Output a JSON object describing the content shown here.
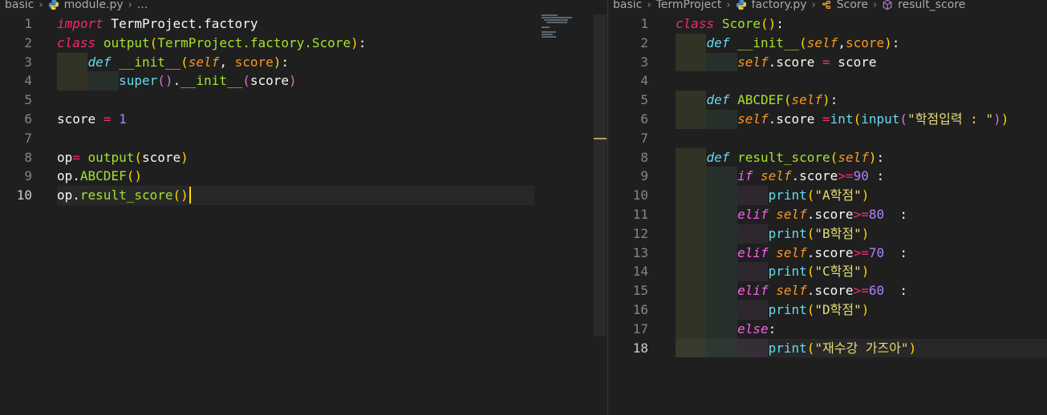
{
  "left": {
    "breadcrumb": [
      "basic",
      "module.py",
      "..."
    ],
    "lines": [
      {
        "n": "1",
        "tokens": [
          [
            "kw",
            "import"
          ],
          [
            "pl",
            " TermProject.factory"
          ]
        ]
      },
      {
        "n": "2",
        "tokens": [
          [
            "kw",
            "class"
          ],
          [
            "pl",
            " "
          ],
          [
            "cls",
            "output"
          ],
          [
            "brk1",
            "("
          ],
          [
            "cls",
            "TermProject.factory.Score"
          ],
          [
            "brk1",
            ")"
          ],
          [
            "pl",
            ":"
          ]
        ]
      },
      {
        "n": "3",
        "tokens": [
          [
            "pl",
            "    "
          ],
          [
            "kw2",
            "def"
          ],
          [
            "pl",
            " "
          ],
          [
            "def-name",
            "__init__"
          ],
          [
            "brk1",
            "("
          ],
          [
            "selfp",
            "self"
          ],
          [
            "pl",
            ", "
          ],
          [
            "param",
            "score"
          ],
          [
            "brk1",
            ")"
          ],
          [
            "pl",
            ":"
          ]
        ]
      },
      {
        "n": "4",
        "tokens": [
          [
            "pl",
            "        "
          ],
          [
            "bi",
            "super"
          ],
          [
            "brk2",
            "()"
          ],
          [
            "pl",
            "."
          ],
          [
            "fn",
            "__init__"
          ],
          [
            "brk2",
            "("
          ],
          [
            "pv",
            "score"
          ],
          [
            "brk2",
            ")"
          ]
        ]
      },
      {
        "n": "5",
        "tokens": []
      },
      {
        "n": "6",
        "tokens": [
          [
            "pl",
            "score "
          ],
          [
            "op",
            "="
          ],
          [
            "pl",
            " "
          ],
          [
            "num",
            "1"
          ]
        ]
      },
      {
        "n": "7",
        "tokens": []
      },
      {
        "n": "8",
        "tokens": [
          [
            "pl",
            "op"
          ],
          [
            "op",
            "="
          ],
          [
            "pl",
            " "
          ],
          [
            "fn",
            "output"
          ],
          [
            "brk1",
            "("
          ],
          [
            "pv",
            "score"
          ],
          [
            "brk1",
            ")"
          ]
        ]
      },
      {
        "n": "9",
        "tokens": [
          [
            "pl",
            "op."
          ],
          [
            "fn",
            "ABCDEF"
          ],
          [
            "brk1",
            "()"
          ]
        ]
      },
      {
        "n": "10",
        "tokens": [
          [
            "pl",
            "op."
          ],
          [
            "fn",
            "result_score"
          ],
          [
            "brk1",
            "()"
          ]
        ]
      }
    ],
    "active_line": "10"
  },
  "right": {
    "breadcrumb": [
      "basic",
      "TermProject",
      "factory.py",
      "Score",
      "result_score"
    ],
    "lines": [
      {
        "n": "1",
        "tokens": [
          [
            "kw",
            "class"
          ],
          [
            "pl",
            " "
          ],
          [
            "cls",
            "Score"
          ],
          [
            "brk1",
            "()"
          ],
          [
            "pl",
            ":"
          ]
        ]
      },
      {
        "n": "2",
        "tokens": [
          [
            "pl",
            "    "
          ],
          [
            "kw2",
            "def"
          ],
          [
            "pl",
            " "
          ],
          [
            "def-name",
            "__init__"
          ],
          [
            "brk1",
            "("
          ],
          [
            "selfp",
            "self"
          ],
          [
            "pl",
            ","
          ],
          [
            "param",
            "score"
          ],
          [
            "brk1",
            ")"
          ],
          [
            "pl",
            ":"
          ]
        ]
      },
      {
        "n": "3",
        "tokens": [
          [
            "pl",
            "        "
          ],
          [
            "selfp",
            "self"
          ],
          [
            "pl",
            ".score "
          ],
          [
            "op",
            "="
          ],
          [
            "pl",
            " score"
          ]
        ]
      },
      {
        "n": "4",
        "tokens": []
      },
      {
        "n": "5",
        "tokens": [
          [
            "pl",
            "    "
          ],
          [
            "kw2",
            "def"
          ],
          [
            "pl",
            " "
          ],
          [
            "def-name",
            "ABCDEF"
          ],
          [
            "brk1",
            "("
          ],
          [
            "selfp",
            "self"
          ],
          [
            "brk1",
            ")"
          ],
          [
            "pl",
            ":"
          ]
        ]
      },
      {
        "n": "6",
        "tokens": [
          [
            "pl",
            "        "
          ],
          [
            "selfp",
            "self"
          ],
          [
            "pl",
            ".score "
          ],
          [
            "op",
            "="
          ],
          [
            "bi",
            "int"
          ],
          [
            "brk1",
            "("
          ],
          [
            "bi",
            "input"
          ],
          [
            "brk2",
            "("
          ],
          [
            "str",
            "\"학점입력 : \""
          ],
          [
            "brk2",
            ")"
          ],
          [
            "brk1",
            ")"
          ]
        ]
      },
      {
        "n": "7",
        "tokens": []
      },
      {
        "n": "8",
        "tokens": [
          [
            "pl",
            "    "
          ],
          [
            "kw2",
            "def"
          ],
          [
            "pl",
            " "
          ],
          [
            "def-name",
            "result_score"
          ],
          [
            "brk1",
            "("
          ],
          [
            "selfp",
            "self"
          ],
          [
            "brk1",
            ")"
          ],
          [
            "pl",
            ":"
          ]
        ]
      },
      {
        "n": "9",
        "tokens": [
          [
            "pl",
            "        "
          ],
          [
            "kwc",
            "if"
          ],
          [
            "pl",
            " "
          ],
          [
            "selfp",
            "self"
          ],
          [
            "pl",
            ".score"
          ],
          [
            "op",
            ">="
          ],
          [
            "num",
            "90"
          ],
          [
            "pl",
            " :"
          ]
        ]
      },
      {
        "n": "10",
        "tokens": [
          [
            "pl",
            "            "
          ],
          [
            "bi",
            "print"
          ],
          [
            "brk1",
            "("
          ],
          [
            "str",
            "\"A학점\""
          ],
          [
            "brk1",
            ")"
          ]
        ]
      },
      {
        "n": "11",
        "tokens": [
          [
            "pl",
            "        "
          ],
          [
            "kwc",
            "elif"
          ],
          [
            "pl",
            " "
          ],
          [
            "selfp",
            "self"
          ],
          [
            "pl",
            ".score"
          ],
          [
            "op",
            ">="
          ],
          [
            "num",
            "80"
          ],
          [
            "pl",
            "  :"
          ]
        ]
      },
      {
        "n": "12",
        "tokens": [
          [
            "pl",
            "            "
          ],
          [
            "bi",
            "print"
          ],
          [
            "brk1",
            "("
          ],
          [
            "str",
            "\"B학점\""
          ],
          [
            "brk1",
            ")"
          ]
        ]
      },
      {
        "n": "13",
        "tokens": [
          [
            "pl",
            "        "
          ],
          [
            "kwc",
            "elif"
          ],
          [
            "pl",
            " "
          ],
          [
            "selfp",
            "self"
          ],
          [
            "pl",
            ".score"
          ],
          [
            "op",
            ">="
          ],
          [
            "num",
            "70"
          ],
          [
            "pl",
            "  :"
          ]
        ]
      },
      {
        "n": "14",
        "tokens": [
          [
            "pl",
            "            "
          ],
          [
            "bi",
            "print"
          ],
          [
            "brk1",
            "("
          ],
          [
            "str",
            "\"C학점\""
          ],
          [
            "brk1",
            ")"
          ]
        ]
      },
      {
        "n": "15",
        "tokens": [
          [
            "pl",
            "        "
          ],
          [
            "kwc",
            "elif"
          ],
          [
            "pl",
            " "
          ],
          [
            "selfp",
            "self"
          ],
          [
            "pl",
            ".score"
          ],
          [
            "op",
            ">="
          ],
          [
            "num",
            "60"
          ],
          [
            "pl",
            "  :"
          ]
        ]
      },
      {
        "n": "16",
        "tokens": [
          [
            "pl",
            "            "
          ],
          [
            "bi",
            "print"
          ],
          [
            "brk1",
            "("
          ],
          [
            "str",
            "\"D학점\""
          ],
          [
            "brk1",
            ")"
          ]
        ]
      },
      {
        "n": "17",
        "tokens": [
          [
            "pl",
            "        "
          ],
          [
            "kwc",
            "else"
          ],
          [
            "pl",
            ":"
          ]
        ]
      },
      {
        "n": "18",
        "tokens": [
          [
            "pl",
            "            "
          ],
          [
            "bi",
            "print"
          ],
          [
            "brk1",
            "("
          ],
          [
            "str",
            "\"재수강 가즈아\""
          ],
          [
            "brk1",
            ")"
          ]
        ]
      }
    ],
    "active_line": "18"
  },
  "colors": {
    "background": "#1f1f1f",
    "line_number": "#858585",
    "active_line_number": "#cccccc",
    "caret": "#ffd700"
  },
  "icons": {
    "file_icon": "python-file-icon",
    "class_icon": "class-symbol-icon",
    "method_icon": "method-symbol-icon"
  }
}
